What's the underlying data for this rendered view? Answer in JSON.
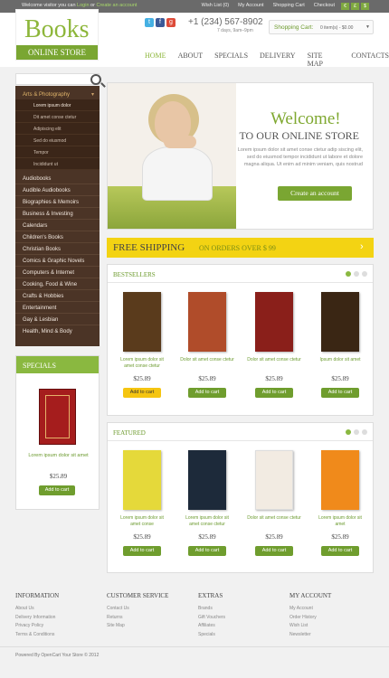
{
  "topbar": {
    "welcome": "Welcome visitor you can",
    "login": "Login",
    "or": "or",
    "create": "Create an account",
    "links": [
      "Wish List (0)",
      "My Account",
      "Shopping Cart",
      "Checkout"
    ],
    "currencies": [
      "€",
      "£",
      "$"
    ]
  },
  "header": {
    "logo_big": "Books",
    "logo_small": "ONLINE STORE",
    "phone": "+1 (234) 567-8902",
    "hours": "7 days, 9am–9pm",
    "cart_label": "Shopping Cart:",
    "cart_value": "0 item(s) - $0.00",
    "social": [
      "t",
      "f",
      "g"
    ]
  },
  "nav": [
    "HOME",
    "ABOUT",
    "SPECIALS",
    "DELIVERY",
    "SITE MAP",
    "CONTACTS"
  ],
  "categories": {
    "top": {
      "label": "Arts & Photography",
      "chev": "▾"
    },
    "subs": [
      "Lorem ipsum dolor",
      "Dit amet conse ctetur",
      "Adipiscing elit",
      "Sed do eiusmod",
      "Tempor",
      "Incididunt ut"
    ],
    "items": [
      "Audiobooks",
      "Audible Audiobooks",
      "Biographies & Memoirs",
      "Business & Investing",
      "Calendars",
      "Children's Books",
      "Christian Books",
      "Comics & Graphic Novels",
      "Computers & Internet",
      "Cooking, Food & Wine",
      "Crafts & Hobbies",
      "Entertainment",
      "Gay & Lesbian",
      "Health, Mind & Body"
    ]
  },
  "specials": {
    "title": "SPECIALS",
    "product": {
      "name": "Lorem ipsum dolor sit amet",
      "price": "$25.89",
      "button": "Add to cart"
    }
  },
  "hero": {
    "welcome": "Welcome!",
    "subtitle": "TO OUR ONLINE STORE",
    "text": "Lorem ipsum dolor sit amet conse ctetur adip siscing elit, sed do eiusmod tempor incididunt ut labore et dolore magna aliqua. Ut enim ad minim veniam, quis nostrud",
    "button": "Create an account"
  },
  "shipping": {
    "a": "FREE SHIPPING",
    "b": "ON ORDERS OVER $ 99",
    "arrow": "›"
  },
  "bestsellers": {
    "title": "BESTSELLERS",
    "items": [
      {
        "name": "Lorem ipsum dolor sit amet conse ctetur",
        "price": "$25.89",
        "button": "Add to cart",
        "color": "#5a3b1c"
      },
      {
        "name": "Dolor sit amet conse ctetur",
        "price": "$25.89",
        "button": "Add to cart",
        "color": "#b04c2a"
      },
      {
        "name": "Dolor sit amet conse ctetur",
        "price": "$25.89",
        "button": "Add to cart",
        "color": "#8a1f1a"
      },
      {
        "name": "Ipsum dolor sit amet",
        "price": "$25.89",
        "button": "Add to cart",
        "color": "#3a2614"
      }
    ]
  },
  "featured": {
    "title": "FEATURED",
    "items": [
      {
        "name": "Lorem ipsum dolor sit amet conse",
        "price": "$25.89",
        "button": "Add to cart",
        "color": "#e5d93a"
      },
      {
        "name": "Lorem ipsum dolor sit amet conse ctetur",
        "price": "$25.89",
        "button": "Add to cart",
        "color": "#1d2a3a"
      },
      {
        "name": "Dolor sit amet conse ctetur",
        "price": "$25.89",
        "button": "Add to cart",
        "color": "#f2ebe2"
      },
      {
        "name": "Lorem ipsum dolor sit amet",
        "price": "$25.89",
        "button": "Add to cart",
        "color": "#f08a1b"
      }
    ]
  },
  "footer": {
    "cols": [
      {
        "title": "INFORMATION",
        "items": [
          "About Us",
          "Delivery Information",
          "Privacy Policy",
          "Terms & Conditions"
        ]
      },
      {
        "title": "CUSTOMER SERVICE",
        "items": [
          "Contact Us",
          "Returns",
          "Site Map"
        ]
      },
      {
        "title": "EXTRAS",
        "items": [
          "Brands",
          "Gift Vouchers",
          "Affiliates",
          "Specials"
        ]
      },
      {
        "title": "MY ACCOUNT",
        "items": [
          "My Account",
          "Order History",
          "Wish List",
          "Newsletter"
        ]
      }
    ],
    "copyright": "Powered By OpenCart Your Store © 2012"
  },
  "colors": {
    "accent": "#7aa632",
    "brown": "#4b3426",
    "yellow": "#f3d313"
  }
}
